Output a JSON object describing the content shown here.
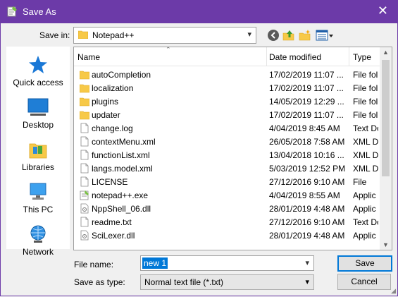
{
  "window": {
    "title": "Save As"
  },
  "save_in": {
    "label": "Save in:",
    "value": "Notepad++"
  },
  "toolbar": {
    "back_icon": "back-arrow-icon",
    "up_icon": "up-folder-icon",
    "new_folder_icon": "new-folder-icon",
    "views_icon": "view-menu-icon"
  },
  "places": [
    {
      "label": "Quick access",
      "icon": "star-icon"
    },
    {
      "label": "Desktop",
      "icon": "desktop-icon"
    },
    {
      "label": "Libraries",
      "icon": "libraries-icon"
    },
    {
      "label": "This PC",
      "icon": "computer-icon"
    },
    {
      "label": "Network",
      "icon": "network-icon"
    }
  ],
  "columns": {
    "name": "Name",
    "date": "Date modified",
    "type": "Type"
  },
  "files": [
    {
      "name": "autoCompletion",
      "date": "17/02/2019 11:07 ...",
      "type": "File fol",
      "icon": "folder"
    },
    {
      "name": "localization",
      "date": "17/02/2019 11:07 ...",
      "type": "File fol",
      "icon": "folder"
    },
    {
      "name": "plugins",
      "date": "14/05/2019 12:29 ...",
      "type": "File fol",
      "icon": "folder"
    },
    {
      "name": "updater",
      "date": "17/02/2019 11:07 ...",
      "type": "File fol",
      "icon": "folder"
    },
    {
      "name": "change.log",
      "date": "4/04/2019 8:45 AM",
      "type": "Text Do",
      "icon": "file"
    },
    {
      "name": "contextMenu.xml",
      "date": "26/05/2018 7:58 AM",
      "type": "XML D",
      "icon": "file"
    },
    {
      "name": "functionList.xml",
      "date": "13/04/2018 10:16 ...",
      "type": "XML D",
      "icon": "file"
    },
    {
      "name": "langs.model.xml",
      "date": "5/03/2019 12:52 PM",
      "type": "XML D",
      "icon": "file"
    },
    {
      "name": "LICENSE",
      "date": "27/12/2016 9:10 AM",
      "type": "File",
      "icon": "file"
    },
    {
      "name": "notepad++.exe",
      "date": "4/04/2019 8:55 AM",
      "type": "Applic",
      "icon": "exe"
    },
    {
      "name": "NppShell_06.dll",
      "date": "28/01/2019 4:48 AM",
      "type": "Applic",
      "icon": "dll"
    },
    {
      "name": "readme.txt",
      "date": "27/12/2016 9:10 AM",
      "type": "Text Do",
      "icon": "file"
    },
    {
      "name": "SciLexer.dll",
      "date": "28/01/2019 4:48 AM",
      "type": "Applic",
      "icon": "dll"
    }
  ],
  "file_name": {
    "label": "File name:",
    "value": "new 1"
  },
  "save_type": {
    "label": "Save as type:",
    "value": "Normal text file (*.txt)"
  },
  "buttons": {
    "save": "Save",
    "cancel": "Cancel"
  },
  "colors": {
    "titlebar": "#6c3aa8",
    "selection": "#0078d7",
    "folder": "#f7c948"
  }
}
